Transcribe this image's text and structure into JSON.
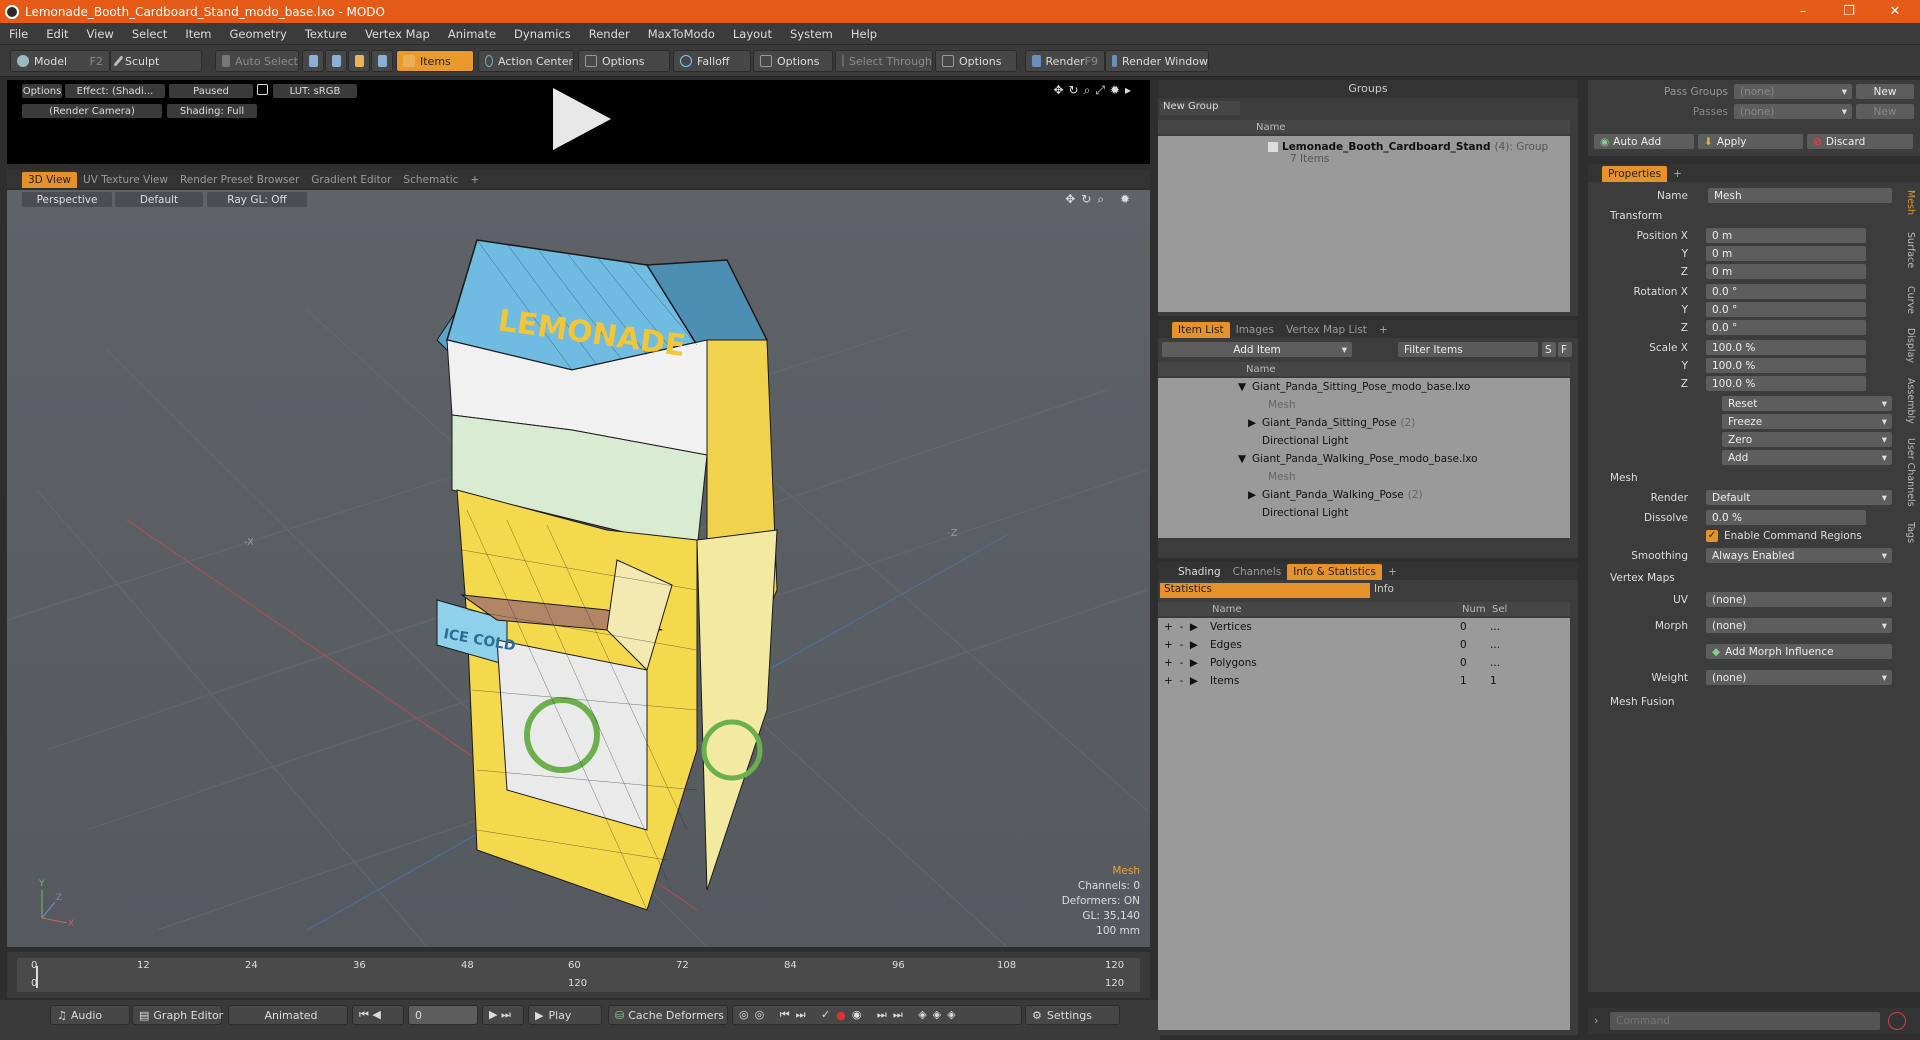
{
  "window": {
    "title": "Lemonade_Booth_Cardboard_Stand_modo_base.lxo - MODO",
    "minimize": "–",
    "maximize": "❐",
    "close": "✕"
  },
  "menu": [
    "File",
    "Edit",
    "View",
    "Select",
    "Item",
    "Geometry",
    "Texture",
    "Vertex Map",
    "Animate",
    "Dynamics",
    "Render",
    "MaxToModo",
    "Layout",
    "System",
    "Help"
  ],
  "toolbar": {
    "model": "Model",
    "model_key": "F2",
    "sculpt": "Sculpt",
    "auto_select": "Auto Select",
    "items": "Items",
    "action_center": "Action Center",
    "options1": "Options",
    "falloff": "Falloff",
    "options2": "Options",
    "select_through": "Select Through",
    "options3": "Options",
    "render": "Render",
    "render_key": "F9",
    "render_window": "Render Window"
  },
  "preview": {
    "options": "Options",
    "effect": "Effect: (Shadi...",
    "paused": "Paused",
    "lut": "LUT: sRGB",
    "camera": "(Render Camera)",
    "shading": "Shading: Full"
  },
  "viewport_tabs": [
    "3D View",
    "UV Texture View",
    "Render Preset Browser",
    "Gradient Editor",
    "Schematic"
  ],
  "viewport": {
    "perspective": "Perspective",
    "default": "Default",
    "raygl": "Ray GL: Off",
    "hud": {
      "mesh": "Mesh",
      "channels": "Channels: 0",
      "deformers": "Deformers: ON",
      "gl": "GL: 35,140",
      "scale": "100 mm"
    },
    "axis_x": "X",
    "axis_y": "Y",
    "axis_z": "Z",
    "label_x": "-X",
    "label_z": "-Z",
    "sign_main": "LEMONADE",
    "sign_side": "ICE COLD"
  },
  "timeline": {
    "ticks": [
      "0",
      "12",
      "24",
      "36",
      "48",
      "60",
      "72",
      "84",
      "96",
      "108",
      "120"
    ],
    "sub_ticks": [
      "0",
      "120",
      "120"
    ]
  },
  "bottom": {
    "audio": "Audio",
    "graph_editor": "Graph Editor",
    "animated": "Animated",
    "frame": "0",
    "play": "Play",
    "cache": "Cache Deformers",
    "settings": "Settings"
  },
  "groups": {
    "title": "Groups",
    "new_group": "New Group",
    "col_name": "Name",
    "item_name": "Lemonade_Booth_Cardboard_Stand",
    "item_count": "(4)",
    "item_type": ": Group",
    "item_sub": "7 Items"
  },
  "itemlist": {
    "tabs": [
      "Item List",
      "Images",
      "Vertex Map List"
    ],
    "add_item": "Add Item",
    "filter": "Filter Items",
    "col_name": "Name",
    "s": "S",
    "f": "F",
    "rows": [
      {
        "name": "Giant_Panda_Sitting_Pose_modo_base.lxo",
        "indent": 0,
        "arrow": "▼",
        "dim": false,
        "count": ""
      },
      {
        "name": "Mesh",
        "indent": 2,
        "arrow": "",
        "dim": true,
        "count": ""
      },
      {
        "name": "Giant_Panda_Sitting_Pose",
        "indent": 1,
        "arrow": "▶",
        "dim": false,
        "count": "(2)"
      },
      {
        "name": "Directional Light",
        "indent": 1,
        "arrow": "",
        "dim": false,
        "count": ""
      },
      {
        "name": "Giant_Panda_Walking_Pose_modo_base.lxo",
        "indent": 0,
        "arrow": "▼",
        "dim": false,
        "count": ""
      },
      {
        "name": "Mesh",
        "indent": 2,
        "arrow": "",
        "dim": true,
        "count": ""
      },
      {
        "name": "Giant_Panda_Walking_Pose",
        "indent": 1,
        "arrow": "▶",
        "dim": false,
        "count": "(2)"
      },
      {
        "name": "Directional Light",
        "indent": 1,
        "arrow": "",
        "dim": false,
        "count": ""
      }
    ]
  },
  "stats": {
    "tabs": [
      "Shading",
      "Channels",
      "Info & Statistics"
    ],
    "statistics": "Statistics",
    "info": "Info",
    "col_name": "Name",
    "col_num": "Num",
    "col_sel": "Sel",
    "rows": [
      {
        "name": "Vertices",
        "num": "0",
        "sel": "..."
      },
      {
        "name": "Edges",
        "num": "0",
        "sel": "..."
      },
      {
        "name": "Polygons",
        "num": "0",
        "sel": "..."
      },
      {
        "name": "Items",
        "num": "1",
        "sel": "1"
      }
    ]
  },
  "passes": {
    "pass_groups": "Pass Groups",
    "passes": "Passes",
    "none1": "(none)",
    "none2": "(none)",
    "new1": "New",
    "new2": "New",
    "auto_add": "Auto Add",
    "apply": "Apply",
    "discard": "Discard"
  },
  "properties": {
    "tab": "Properties",
    "name_label": "Name",
    "name_value": "Mesh",
    "transform": "Transform",
    "position_x_label": "Position X",
    "y_label": "Y",
    "z_label": "Z",
    "pos_x": "0 m",
    "pos_y": "0 m",
    "pos_z": "0 m",
    "rotation_x_label": "Rotation X",
    "rot_x": "0.0 °",
    "rot_y": "0.0 °",
    "rot_z": "0.0 °",
    "scale_x_label": "Scale X",
    "scl_x": "100.0 %",
    "scl_y": "100.0 %",
    "scl_z": "100.0 %",
    "reset": "Reset",
    "freeze": "Freeze",
    "zero": "Zero",
    "add": "Add",
    "mesh": "Mesh",
    "render_label": "Render",
    "render_value": "Default",
    "dissolve_label": "Dissolve",
    "dissolve_value": "0.0 %",
    "enable_cmd": "Enable Command Regions",
    "smoothing_label": "Smoothing",
    "smoothing_value": "Always Enabled",
    "vertex_maps": "Vertex Maps",
    "uv_label": "UV",
    "uv_value": "(none)",
    "morph_label": "Morph",
    "morph_value": "(none)",
    "add_morph": "Add Morph Influence",
    "weight_label": "Weight",
    "weight_value": "(none)",
    "mesh_fusion": "Mesh Fusion",
    "side_tabs": [
      "Mesh",
      "Surface",
      "Curve",
      "Display",
      "Assembly",
      "User Channels",
      "Tags"
    ]
  },
  "command": {
    "placeholder": "Command"
  }
}
